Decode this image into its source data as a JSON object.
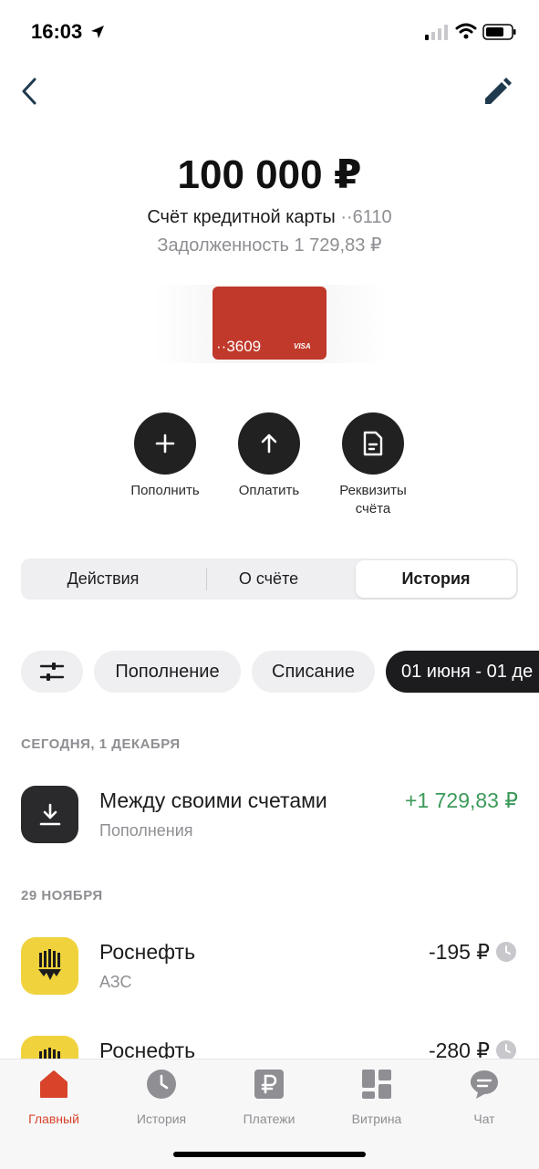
{
  "status_bar": {
    "time": "16:03"
  },
  "header": {
    "back_icon": "chevron-left-icon",
    "edit_icon": "pencil-icon"
  },
  "account": {
    "balance": "100 000 ₽",
    "name": "Счёт кредитной карты",
    "number": "··6110",
    "debt": "Задолженность 1 729,83 ₽"
  },
  "card": {
    "number": "··3609",
    "brand": "VISA",
    "color": "#c0392b"
  },
  "actions": [
    {
      "label": "Пополнить",
      "icon": "plus-icon"
    },
    {
      "label": "Оплатить",
      "icon": "arrow-up-icon"
    },
    {
      "label": "Реквизиты счёта",
      "icon": "document-icon"
    }
  ],
  "tabs": [
    {
      "label": "Действия",
      "active": false
    },
    {
      "label": "О счёте",
      "active": false
    },
    {
      "label": "История",
      "active": true
    }
  ],
  "filters": [
    {
      "label": "",
      "icon": "sliders-icon"
    },
    {
      "label": "Пополнение"
    },
    {
      "label": "Списание"
    },
    {
      "label": "01 июня - 01 де",
      "selected": true
    }
  ],
  "sections": [
    {
      "header": "СЕГОДНЯ, 1 ДЕКАБРЯ",
      "transactions": [
        {
          "title": "Между своими счетами",
          "subtitle": "Пополнения",
          "amount": "+1 729,83 ₽",
          "icon": "download-icon",
          "pending": false
        }
      ]
    },
    {
      "header": "29 НОЯБРЯ",
      "transactions": [
        {
          "title": "Роснефть",
          "subtitle": "АЗС",
          "amount": "-195 ₽",
          "icon": "rosneft-logo-icon",
          "pending": true
        },
        {
          "title": "Роснефть",
          "subtitle": "",
          "amount": "-280 ₽",
          "icon": "rosneft-logo-icon",
          "pending": true
        }
      ]
    }
  ],
  "bottom_nav": [
    {
      "label": "Главный",
      "icon": "home-icon",
      "active": true
    },
    {
      "label": "История",
      "icon": "clock-icon",
      "active": false
    },
    {
      "label": "Платежи",
      "icon": "ruble-icon",
      "active": false
    },
    {
      "label": "Витрина",
      "icon": "grid-icon",
      "active": false
    },
    {
      "label": "Чат",
      "icon": "chat-icon",
      "active": false
    }
  ],
  "colors": {
    "accent": "#d8432a",
    "positive": "#3c9a5a",
    "dark": "#1c1c1e",
    "rosneft_yellow": "#f0d23c"
  }
}
